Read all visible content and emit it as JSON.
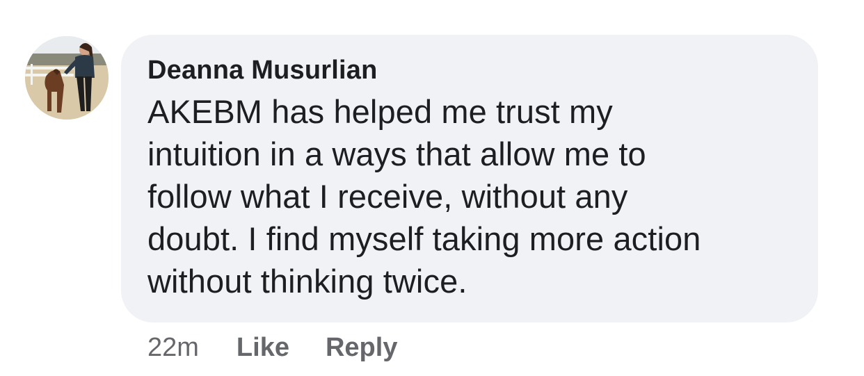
{
  "comment": {
    "author": "Deanna Musurlian",
    "text": "AKEBM has helped me trust my\nintuition in a ways that allow me to\nfollow what I receive, without any\ndoubt. I find myself taking more action\nwithout thinking twice.",
    "timestamp": "22m",
    "actions": {
      "like_label": "Like",
      "reply_label": "Reply"
    }
  },
  "colors": {
    "bubble_background": "#f0f2f5",
    "author_text": "#1c1e21",
    "body_text": "#1c1e21",
    "meta_text": "#65676b"
  }
}
